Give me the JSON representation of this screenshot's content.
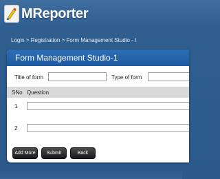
{
  "app": {
    "name": "MReporter"
  },
  "breadcrumb": "Login > Registration > Form Management Studio - I",
  "panel": {
    "title": "Form Management Studio-1"
  },
  "form": {
    "title_label": "Title of form",
    "title_value": "",
    "type_label": "Type of form",
    "type_value": ""
  },
  "table": {
    "headers": {
      "sno": "SNo",
      "question": "Question"
    },
    "rows": [
      {
        "num": "1",
        "value": ""
      },
      {
        "num": "2",
        "value": ""
      }
    ]
  },
  "buttons": {
    "add_more": "Add More",
    "submit": "Submit",
    "back": "Back"
  }
}
